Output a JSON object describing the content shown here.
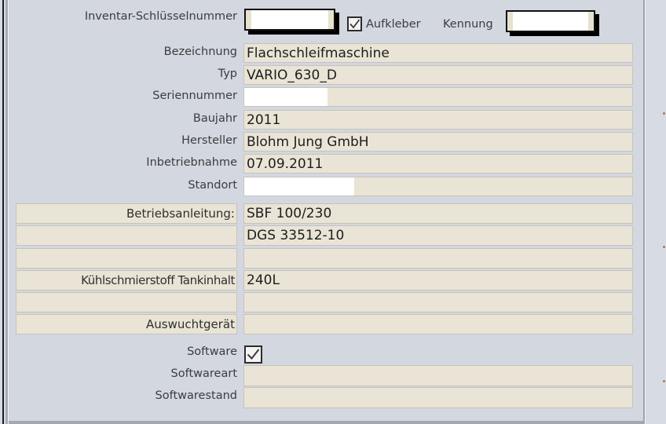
{
  "header": {
    "inventory_key_label": "Inventar-Schlüsselnummer",
    "inventory_key_value": "",
    "sticker_label": "Aufkleber",
    "sticker_checked": true,
    "identifier_label": "Kennung",
    "identifier_value": ""
  },
  "fields": [
    {
      "label": "Bezeichnung",
      "value": "Flachschleifmaschine"
    },
    {
      "label": "Typ",
      "value": "VARIO_630_D"
    },
    {
      "label": "Seriennummer",
      "value": ""
    },
    {
      "label": "Baujahr",
      "value": "2011"
    },
    {
      "label": "Hersteller",
      "value": "Blohm Jung GmbH"
    },
    {
      "label": "Inbetriebnahme",
      "value": "07.09.2011"
    },
    {
      "label": "Standort",
      "value": ""
    }
  ],
  "grid": [
    {
      "label": "Betriebsanleitung:",
      "value": "SBF 100/230"
    },
    {
      "label": "",
      "value": "DGS 33512-10"
    },
    {
      "label": "",
      "value": ""
    },
    {
      "label": "Kühlschmierstoff Tankinhalt",
      "value": "240L"
    },
    {
      "label": "",
      "value": ""
    },
    {
      "label": "Auswuchtgerät",
      "value": ""
    }
  ],
  "software": {
    "label": "Software",
    "checked": true,
    "type_label": "Softwareart",
    "type_value": "",
    "version_label": "Softwarestand",
    "version_value": ""
  }
}
